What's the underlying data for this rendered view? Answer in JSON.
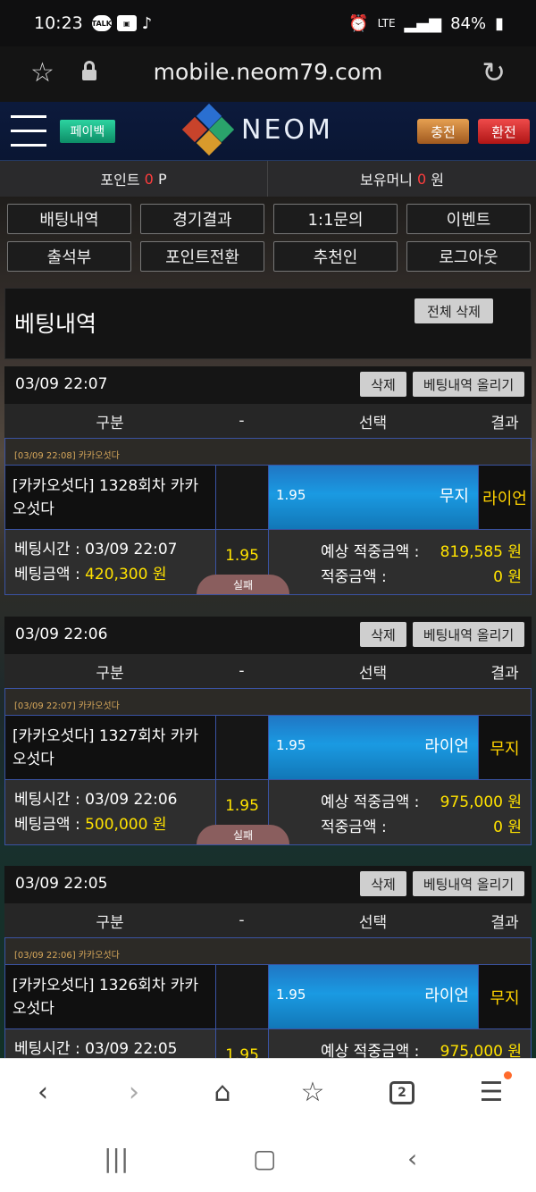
{
  "status": {
    "time": "10:23",
    "battery": "84%",
    "network": "LTE"
  },
  "browser": {
    "url": "mobile.neom79.com",
    "tab_count": "2"
  },
  "header": {
    "payback": "페이백",
    "logo": "NEOM",
    "charge": "충전",
    "exchange": "환전"
  },
  "points": {
    "point_label": "포인트",
    "point_value": "0",
    "point_unit": "P",
    "money_label": "보유머니",
    "money_value": "0",
    "money_unit": "원"
  },
  "menu": [
    "배팅내역",
    "경기결과",
    "1:1문의",
    "이벤트",
    "출석부",
    "포인트전환",
    "추천인",
    "로그아웃"
  ],
  "panel": {
    "title": "베팅내역",
    "delete_all": "전체 삭제"
  },
  "columns": {
    "gubun": "구분",
    "dash": "-",
    "choice": "선택",
    "result": "결과"
  },
  "labels": {
    "delete": "삭제",
    "upload": "베팅내역 올리기",
    "bet_time": "베팅시간 :",
    "bet_amount": "베팅금액 :",
    "expected": "예상 적중금액 :",
    "won": "적중금액 :",
    "fail": "실패"
  },
  "bets": [
    {
      "date": "03/09 22:07",
      "tag": "[03/09 22:08] 카카오섯다",
      "game": "[카카오섯다] 1328회차 카카오섯다",
      "odds": "1.95",
      "pick": "무지",
      "result": "라이언",
      "time": "03/09 22:07",
      "amount": "420,300 원",
      "expected": "819,585 원",
      "won": "0 원",
      "status": "실패"
    },
    {
      "date": "03/09 22:06",
      "tag": "[03/09 22:07] 카카오섯다",
      "game": "[카카오섯다] 1327회차 카카오섯다",
      "odds": "1.95",
      "pick": "라이언",
      "result": "무지",
      "time": "03/09 22:06",
      "amount": "500,000 원",
      "expected": "975,000 원",
      "won": "0 원",
      "status": "실패"
    },
    {
      "date": "03/09 22:05",
      "tag": "[03/09 22:06] 카카오섯다",
      "game": "[카카오섯다] 1326회차 카카오섯다",
      "odds": "1.95",
      "pick": "라이언",
      "result": "무지",
      "time": "03/09 22:05",
      "expected": "975,000 원"
    }
  ]
}
